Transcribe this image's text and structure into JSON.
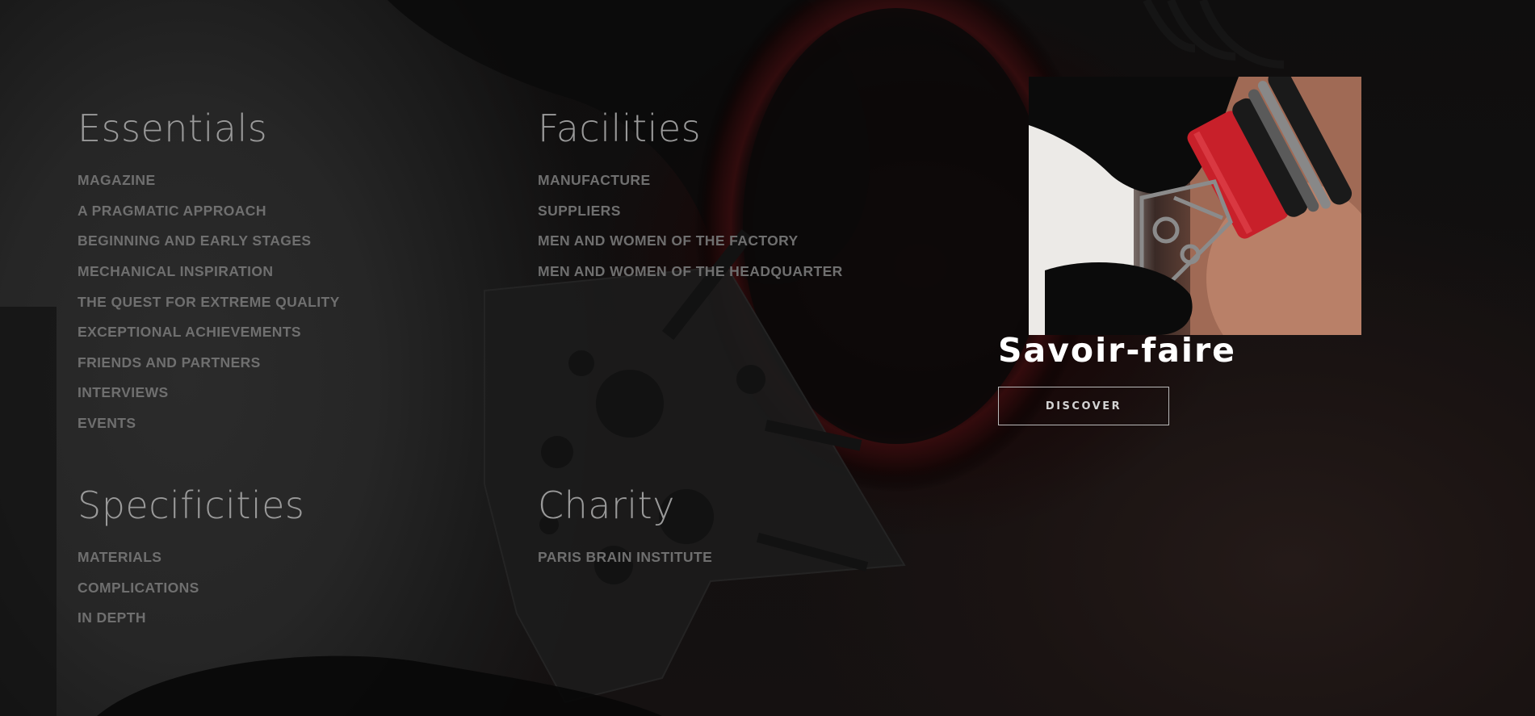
{
  "sections": {
    "essentials": {
      "title": "Essentials",
      "links": [
        {
          "label": "MAGAZINE"
        },
        {
          "label": "A PRAGMATIC APPROACH"
        },
        {
          "label": "BEGINNING AND EARLY STAGES"
        },
        {
          "label": "MECHANICAL INSPIRATION"
        },
        {
          "label": "THE QUEST FOR EXTREME QUALITY"
        },
        {
          "label": "EXCEPTIONAL ACHIEVEMENTS"
        },
        {
          "label": "FRIENDS AND PARTNERS"
        },
        {
          "label": "INTERVIEWS"
        },
        {
          "label": "EVENTS"
        }
      ]
    },
    "facilities": {
      "title": "Facilities",
      "links": [
        {
          "label": "MANUFACTURE"
        },
        {
          "label": "SUPPLIERS"
        },
        {
          "label": "MEN AND WOMEN OF THE FACTORY"
        },
        {
          "label": "MEN AND WOMEN OF THE HEADQUARTER"
        }
      ]
    },
    "specificities": {
      "title": "Specificities",
      "links": [
        {
          "label": "MATERIALS"
        },
        {
          "label": "COMPLICATIONS"
        },
        {
          "label": "IN DEPTH"
        }
      ]
    },
    "charity": {
      "title": "Charity",
      "links": [
        {
          "label": "PARIS BRAIN INSTITUTE"
        }
      ]
    }
  },
  "feature": {
    "title": "Savoir-faire",
    "button_label": "DISCOVER",
    "image_icon": "watchmaker-loupe-photo"
  },
  "colors": {
    "background": "#121010",
    "section_title": "#9a9a9a",
    "link": "#6f6f6f",
    "feature_title": "#ffffff",
    "accent_red": "#c8202a"
  }
}
